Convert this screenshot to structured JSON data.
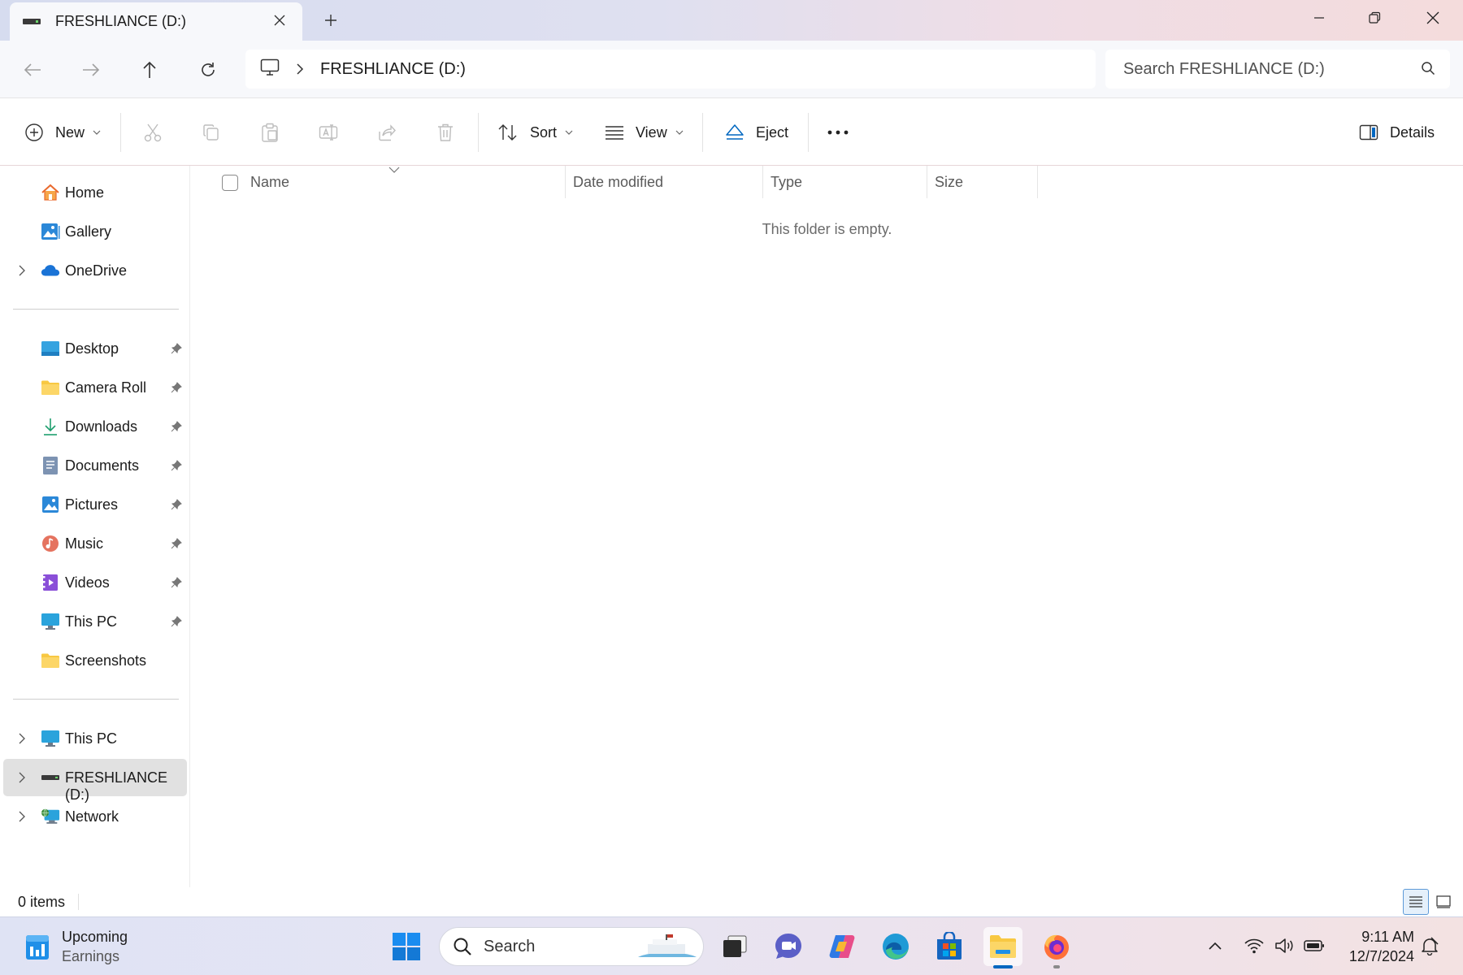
{
  "window": {
    "tab_title": "FRESHLIANCE (D:)",
    "colors": {
      "accent": "#0067c0",
      "selected_bg": "#e1e1e1",
      "folder_yellow": "#f8c842"
    }
  },
  "address": {
    "breadcrumb": [
      "FRESHLIANCE (D:)"
    ],
    "search_placeholder": "Search FRESHLIANCE (D:)"
  },
  "commands": {
    "new_label": "New",
    "sort_label": "Sort",
    "view_label": "View",
    "eject_label": "Eject",
    "details_label": "Details"
  },
  "sidebar": {
    "top": [
      {
        "label": "Home",
        "icon": "home-icon",
        "expandable": false
      },
      {
        "label": "Gallery",
        "icon": "gallery-icon",
        "expandable": false
      },
      {
        "label": "OneDrive",
        "icon": "onedrive-icon",
        "expandable": true
      }
    ],
    "quick_access": [
      {
        "label": "Desktop",
        "icon": "desktop-icon",
        "pinned": true
      },
      {
        "label": "Camera Roll",
        "icon": "folder-icon",
        "pinned": true
      },
      {
        "label": "Downloads",
        "icon": "download-icon",
        "pinned": true
      },
      {
        "label": "Documents",
        "icon": "documents-icon",
        "pinned": true
      },
      {
        "label": "Pictures",
        "icon": "pictures-icon",
        "pinned": true
      },
      {
        "label": "Music",
        "icon": "music-icon",
        "pinned": true
      },
      {
        "label": "Videos",
        "icon": "videos-icon",
        "pinned": true
      },
      {
        "label": "This PC",
        "icon": "monitor-icon",
        "pinned": true
      },
      {
        "label": "Screenshots",
        "icon": "folder-icon",
        "pinned": false
      }
    ],
    "devices": [
      {
        "label": "This PC",
        "icon": "monitor-icon",
        "expandable": true,
        "selected": false
      },
      {
        "label": "FRESHLIANCE (D:)",
        "icon": "drive-icon",
        "expandable": true,
        "selected": true
      },
      {
        "label": "Network",
        "icon": "network-icon",
        "expandable": true,
        "selected": false
      }
    ]
  },
  "content": {
    "columns": [
      "Name",
      "Date modified",
      "Type",
      "Size"
    ],
    "empty_message": "This folder is empty."
  },
  "status": {
    "item_count": "0 items"
  },
  "taskbar": {
    "widget_title": "Upcoming",
    "widget_subtitle": "Earnings",
    "search_label": "Search",
    "apps": [
      "start-icon",
      "task-view-icon",
      "teams-icon",
      "copilot-icon",
      "edge-icon",
      "store-icon",
      "file-explorer-icon",
      "firefox-icon"
    ],
    "time": "9:11 AM",
    "date": "12/7/2024"
  }
}
